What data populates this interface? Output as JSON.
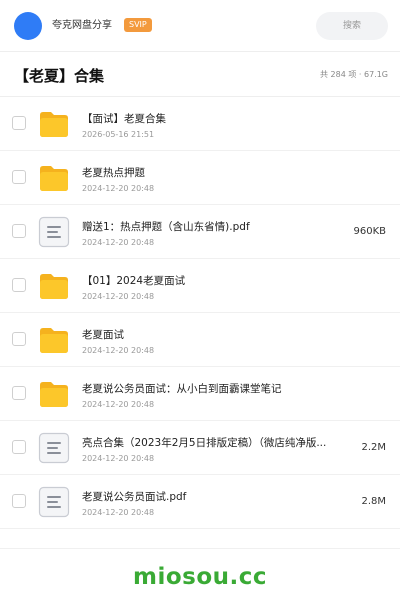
{
  "topbar": {
    "share_name": "夸克网盘分享",
    "badge": "SVIP",
    "search_placeholder": "搜索"
  },
  "header": {
    "title": "【老夏】合集",
    "summary": "共 284 项 · 67.1G"
  },
  "files": [
    {
      "name": "【面试】老夏合集",
      "date": "2026-05-16 21:51",
      "size": "",
      "icon": "folder-icon"
    },
    {
      "name": "老夏热点押题",
      "date": "2024-12-20 20:48",
      "size": "",
      "icon": "folder-icon"
    },
    {
      "name": "赠送1：热点押题（含山东省情).pdf",
      "date": "2024-12-20 20:48",
      "size": "960KB",
      "icon": "document-icon"
    },
    {
      "name": "【01】2024老夏面试",
      "date": "2024-12-20 20:48",
      "size": "",
      "icon": "folder-icon"
    },
    {
      "name": "老夏面试",
      "date": "2024-12-20 20:48",
      "size": "",
      "icon": "folder-icon"
    },
    {
      "name": "老夏说公务员面试：从小白到面霸课堂笔记",
      "date": "2024-12-20 20:48",
      "size": "",
      "icon": "folder-icon"
    },
    {
      "name": "亮点合集（2023年2月5日排版定稿）（微店纯净版...",
      "date": "2024-12-20 20:48",
      "size": "2.2M",
      "icon": "document-icon"
    },
    {
      "name": "老夏说公务员面试.pdf",
      "date": "2024-12-20 20:48",
      "size": "2.8M",
      "icon": "document-icon"
    }
  ],
  "watermark": "miosou.cc",
  "colors": {
    "avatar": "#2f7cf6",
    "svip_badge": "#f39a3d",
    "folder": "#fcc72a",
    "watermark": "#3aaa35"
  }
}
